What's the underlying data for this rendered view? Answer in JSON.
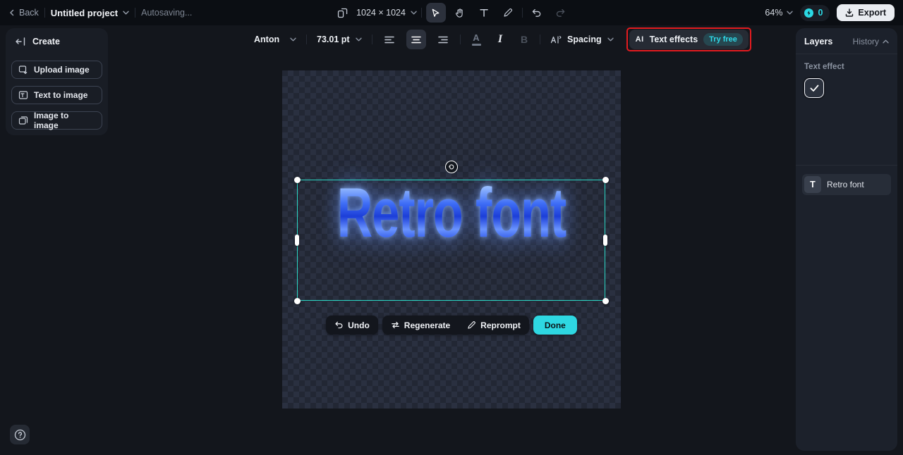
{
  "colors": {
    "accent_cyan": "#2bd9e4",
    "selection_teal": "#2bd9c6",
    "annotation_red": "#e31b1f",
    "export_bg": "#e9ecf1",
    "retro_blue": "#2f5de8"
  },
  "header": {
    "back_label": "Back",
    "project_title": "Untitled project",
    "autosave_status": "Autosaving...",
    "canvas_dimensions": "1024 × 1024",
    "zoom_level": "64%",
    "credits_count": "0",
    "export_label": "Export"
  },
  "toolbar": {
    "font_name": "Anton",
    "font_size": "73.01 pt",
    "spacing_label": "Spacing",
    "ai_icon_glyph": "AI",
    "text_effects_label": "Text effects",
    "try_free_label": "Try free"
  },
  "sidebar": {
    "title": "Create",
    "items": [
      {
        "label": "Upload image"
      },
      {
        "label": "Text to image"
      },
      {
        "label": "Image to image"
      }
    ]
  },
  "layers_panel": {
    "title": "Layers",
    "history_label": "History",
    "section_label": "Text effect",
    "layer": {
      "thumb_glyph": "T",
      "name": "Retro font"
    }
  },
  "canvas": {
    "text_content": "Retro font"
  },
  "actions": {
    "undo_label": "Undo",
    "regenerate_label": "Regenerate",
    "reprompt_label": "Reprompt",
    "done_label": "Done"
  }
}
